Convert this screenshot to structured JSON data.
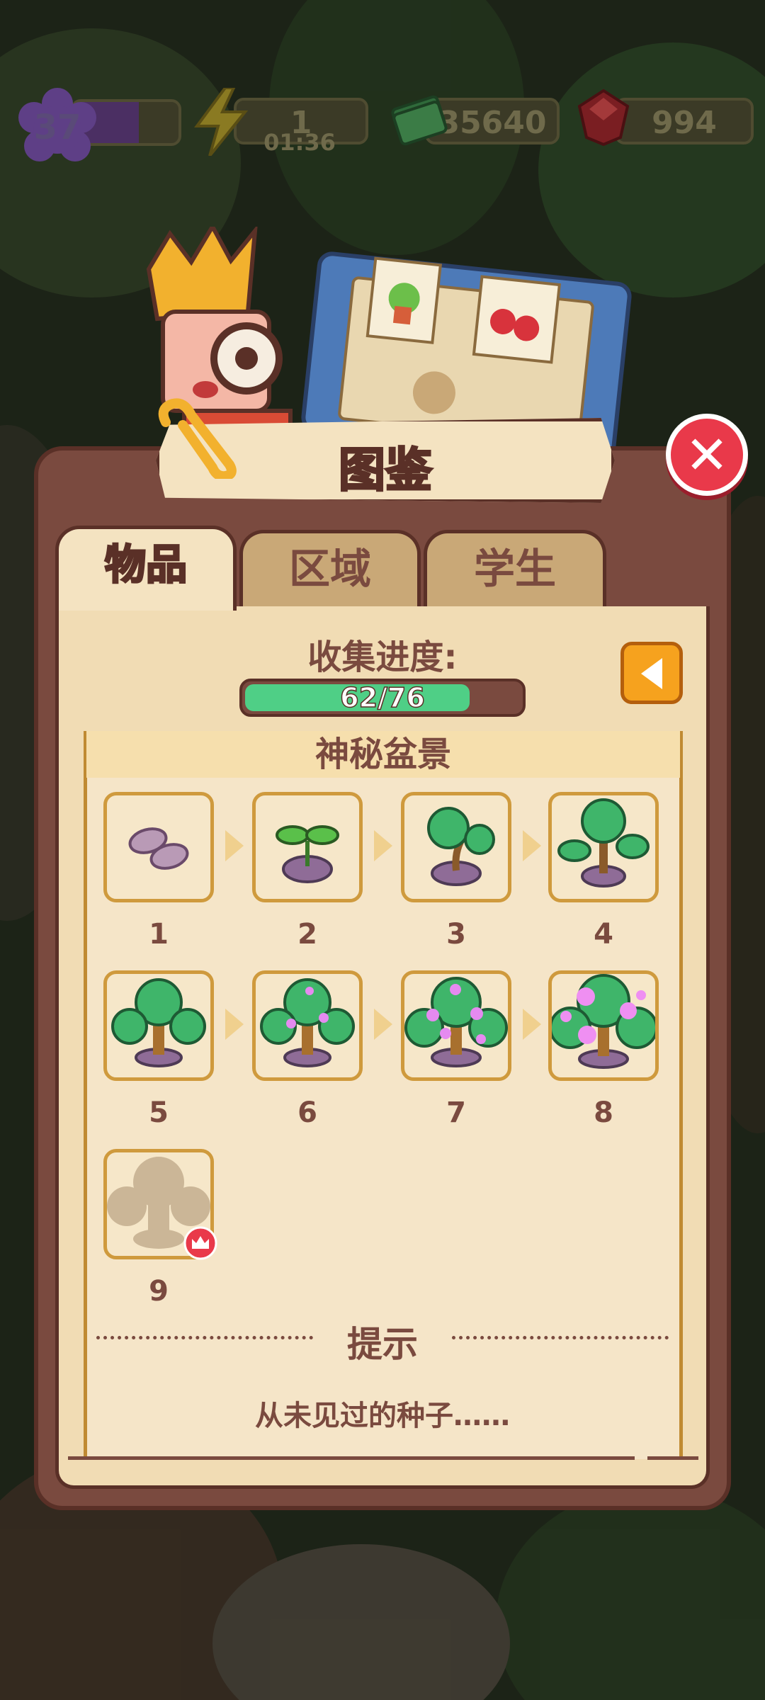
{
  "hud": {
    "level": "37",
    "energy": "1",
    "energy_timer": "01:36",
    "cash": "35640",
    "gems": "994"
  },
  "panel": {
    "title": "图鉴",
    "tabs": [
      "物品",
      "区域",
      "学生"
    ],
    "active_tab": "物品",
    "progress_label": "收集进度:",
    "progress_text": "62/76",
    "progress_fraction": 0.8158,
    "section_title": "神秘盆景",
    "items": [
      {
        "number": "1",
        "stage": "seeds",
        "icon": "seed-icon"
      },
      {
        "number": "2",
        "stage": "sprout",
        "icon": "sprout-icon"
      },
      {
        "number": "3",
        "stage": "sapling",
        "icon": "sapling-icon"
      },
      {
        "number": "4",
        "stage": "small-tree",
        "icon": "small-tree-icon"
      },
      {
        "number": "5",
        "stage": "tree",
        "icon": "tree-icon"
      },
      {
        "number": "6",
        "stage": "budding-tree",
        "icon": "budding-tree-icon"
      },
      {
        "number": "7",
        "stage": "blooming-tree",
        "icon": "blooming-tree-icon"
      },
      {
        "number": "8",
        "stage": "full-bloom-tree",
        "icon": "full-bloom-tree-icon"
      },
      {
        "number": "9",
        "stage": "locked",
        "icon": "locked-silhouette-icon"
      }
    ],
    "hint_label": "提示",
    "hint_text": "从未见过的种子……"
  },
  "colors": {
    "panel_brown": "#7a4a3f",
    "card_cream": "#f1dcb4",
    "item_border": "#cf9a3d",
    "progress_green": "#4fcf86",
    "close_red": "#e9394a",
    "back_orange": "#f6a21e"
  }
}
